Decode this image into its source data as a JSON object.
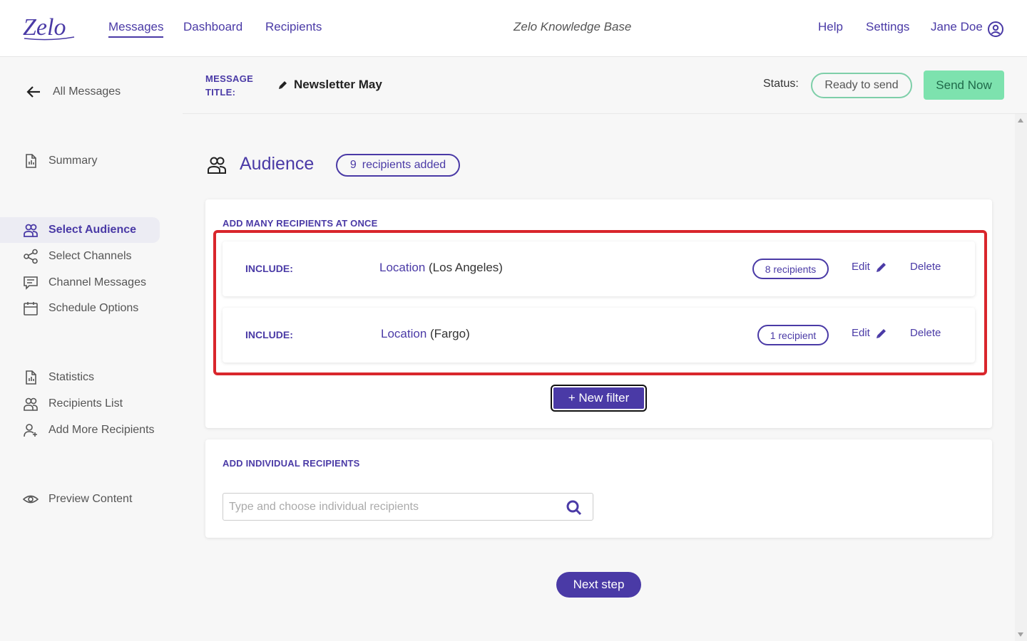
{
  "app": {
    "logo_text": "Zelo"
  },
  "nav": {
    "links": [
      "Messages",
      "Dashboard",
      "Recipients"
    ],
    "knowledge_base": "Zelo Knowledge Base",
    "help": "Help",
    "settings": "Settings",
    "user_name": "Jane Doe"
  },
  "sidebar": {
    "back_label": "All Messages",
    "items": [
      {
        "label": "Summary",
        "icon": "summary-icon"
      },
      {
        "label": "Select Audience",
        "icon": "audience-icon",
        "active": true
      },
      {
        "label": "Select Channels",
        "icon": "channels-icon"
      },
      {
        "label": "Channel Messages",
        "icon": "chat-icon"
      },
      {
        "label": "Schedule Options",
        "icon": "calendar-icon"
      },
      {
        "label": "Statistics",
        "icon": "statistics-icon"
      },
      {
        "label": "Recipients List",
        "icon": "people-icon"
      },
      {
        "label": "Add More Recipients",
        "icon": "add-person-icon"
      },
      {
        "label": "Preview Content",
        "icon": "eye-icon"
      }
    ]
  },
  "header": {
    "title_label_line1": "MESSAGE",
    "title_label_line2": "TITLE:",
    "title": "Newsletter May",
    "status_label": "Status:",
    "status_value": "Ready to send",
    "send_button": "Send Now"
  },
  "audience": {
    "title": "Audience",
    "count": "9",
    "count_suffix": "recipients added"
  },
  "many": {
    "heading": "ADD MANY RECIPIENTS AT ONCE",
    "filters": [
      {
        "include": "INCLUDE:",
        "field": "Location",
        "value": "(Los Angeles)",
        "count": "8 recipients",
        "edit": "Edit",
        "delete": "Delete"
      },
      {
        "include": "INCLUDE:",
        "field": "Location",
        "value": "(Fargo)",
        "count": "1 recipient",
        "edit": "Edit",
        "delete": "Delete"
      }
    ],
    "new_filter": "+ New filter"
  },
  "individual": {
    "heading": "ADD INDIVIDUAL RECIPIENTS",
    "placeholder": "Type and choose individual recipients"
  },
  "next_step": "Next step",
  "colors": {
    "brand": "#4a3aa6",
    "send_green": "#7de2ae",
    "status_border": "#7ecfa9",
    "highlight_red": "#d9262c"
  }
}
